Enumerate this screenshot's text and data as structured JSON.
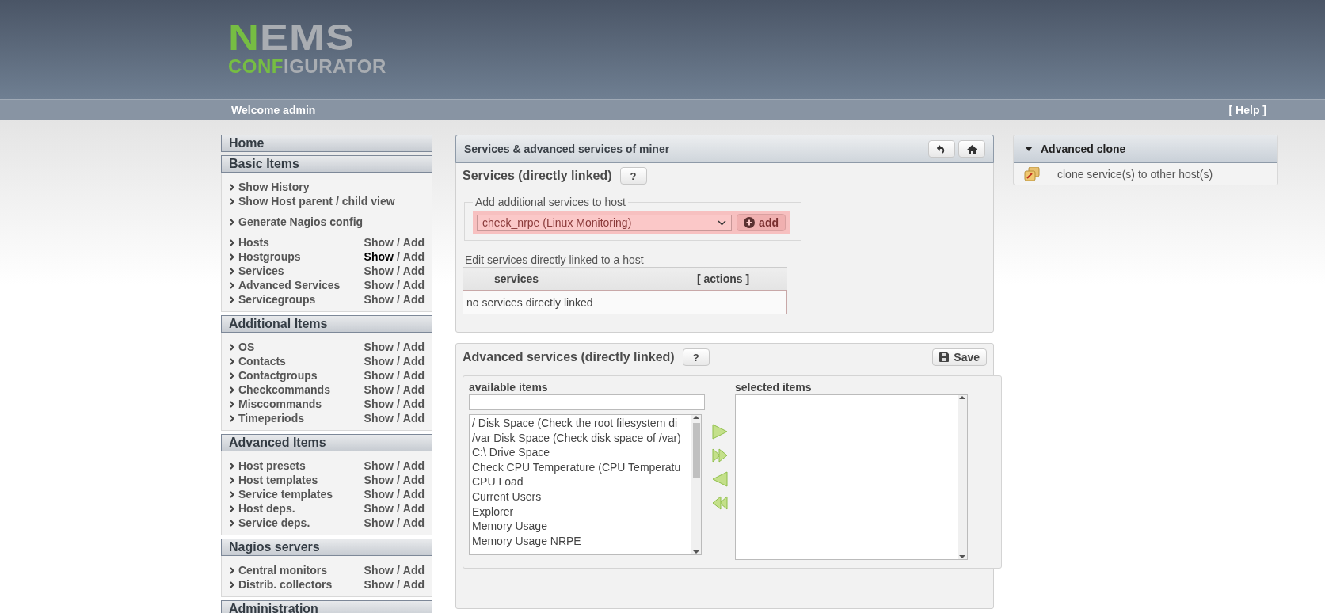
{
  "logo": {
    "mark": "N",
    "word": "EMS",
    "sub_accent": "CONF",
    "sub_rest": "IGURATOR"
  },
  "topbar": {
    "welcome": "Welcome admin",
    "help": "[ Help ]"
  },
  "sidebar": [
    {
      "title": "Home"
    },
    {
      "title": "Basic Items",
      "groups": [
        {
          "items": [
            {
              "label": "Show History"
            },
            {
              "label": "Show Host parent / child view"
            }
          ]
        },
        {
          "items": [
            {
              "label": "Generate Nagios config"
            }
          ]
        },
        {
          "items": [
            {
              "label": "Hosts",
              "show": "Show",
              "sep": "/",
              "add": "Add",
              "show_highlighted": false
            },
            {
              "label": "Hostgroups",
              "show": "Show",
              "sep": "/",
              "add": "Add",
              "show_highlighted": true
            },
            {
              "label": "Services",
              "show": "Show",
              "sep": "/",
              "add": "Add",
              "show_highlighted": false
            },
            {
              "label": "Advanced Services",
              "show": "Show",
              "sep": "/",
              "add": "Add",
              "show_highlighted": false
            },
            {
              "label": "Servicegroups",
              "show": "Show",
              "sep": "/",
              "add": "Add",
              "show_highlighted": false
            }
          ]
        }
      ]
    },
    {
      "title": "Additional Items",
      "groups": [
        {
          "items": [
            {
              "label": "OS",
              "show": "Show",
              "sep": "/",
              "add": "Add",
              "show_highlighted": false
            },
            {
              "label": "Contacts",
              "show": "Show",
              "sep": "/",
              "add": "Add",
              "show_highlighted": false
            },
            {
              "label": "Contactgroups",
              "show": "Show",
              "sep": "/",
              "add": "Add",
              "show_highlighted": false
            },
            {
              "label": "Checkcommands",
              "show": "Show",
              "sep": "/",
              "add": "Add",
              "show_highlighted": false
            },
            {
              "label": "Misccommands",
              "show": "Show",
              "sep": "/",
              "add": "Add",
              "show_highlighted": false
            },
            {
              "label": "Timeperiods",
              "show": "Show",
              "sep": "/",
              "add": "Add",
              "show_highlighted": false
            }
          ]
        }
      ]
    },
    {
      "title": "Advanced Items",
      "groups": [
        {
          "items": [
            {
              "label": "Host presets",
              "show": "Show",
              "sep": "/",
              "add": "Add",
              "show_highlighted": false
            },
            {
              "label": "Host templates",
              "show": "Show",
              "sep": "/",
              "add": "Add",
              "show_highlighted": false
            },
            {
              "label": "Service templates",
              "show": "Show",
              "sep": "/",
              "add": "Add",
              "show_highlighted": false
            },
            {
              "label": "Host deps.",
              "show": "Show",
              "sep": "/",
              "add": "Add",
              "show_highlighted": false
            },
            {
              "label": "Service deps.",
              "show": "Show",
              "sep": "/",
              "add": "Add",
              "show_highlighted": false
            }
          ]
        }
      ]
    },
    {
      "title": "Nagios servers",
      "groups": [
        {
          "items": [
            {
              "label": "Central monitors",
              "show": "Show",
              "sep": "/",
              "add": "Add",
              "show_highlighted": false
            },
            {
              "label": "Distrib. collectors",
              "show": "Show",
              "sep": "/",
              "add": "Add",
              "show_highlighted": false
            }
          ]
        }
      ]
    },
    {
      "title": "Administration"
    }
  ],
  "main": {
    "title": "Services & advanced services of miner",
    "services": {
      "heading": "Services (directly linked)",
      "help": "?",
      "legend": "Add additional services to host",
      "select_value": "check_nrpe (Linux Monitoring)",
      "add_button": "add",
      "table_caption": "Edit services directly linked to a host",
      "columns": [
        "services",
        "[ actions ]"
      ],
      "empty": "no services directly linked"
    },
    "advanced": {
      "heading": "Advanced services (directly linked)",
      "help": "?",
      "save": "Save",
      "available_label": "available items",
      "selected_label": "selected items",
      "available": [
        "/ Disk Space (Check the root filesystem di",
        "/var Disk Space (Check disk space of /var)",
        "C:\\ Drive Space",
        "Check CPU Temperature (CPU Temperatu",
        "CPU Load",
        "Current Users",
        "Explorer",
        "Memory Usage",
        "Memory Usage NRPE"
      ]
    }
  },
  "right": {
    "title": "Advanced clone",
    "items": [
      "clone service(s) to other host(s)"
    ]
  }
}
